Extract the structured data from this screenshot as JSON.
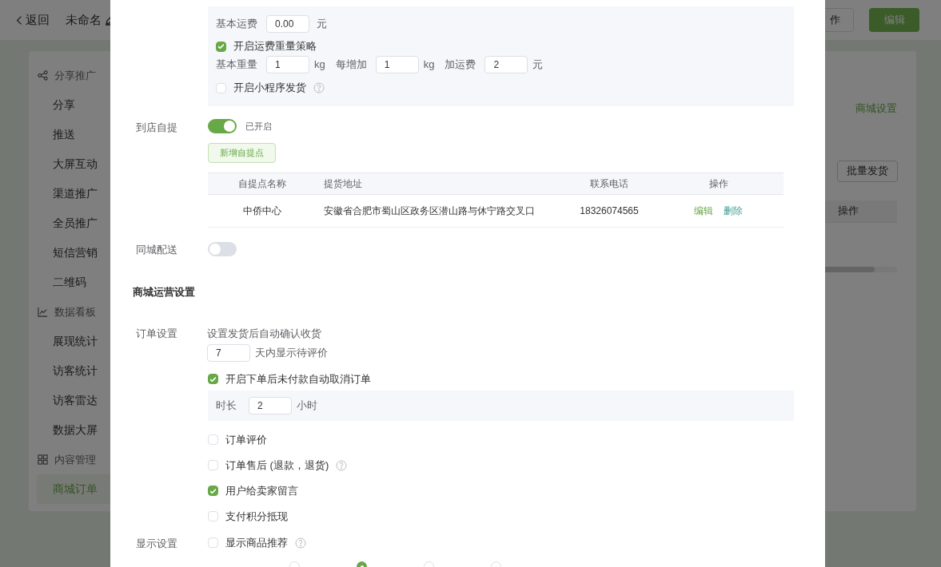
{
  "page": {
    "back": "返回",
    "title": "未命名",
    "header_buttons": [
      {
        "label": "作",
        "kind": "outline"
      },
      {
        "label": "编辑",
        "kind": "primary"
      }
    ],
    "sidebar": [
      {
        "group": "分享推广",
        "items": [
          {
            "label": "分享",
            "selected": false
          },
          {
            "label": "推送",
            "selected": false
          },
          {
            "label": "大屏互动",
            "selected": false
          },
          {
            "label": "渠道推广",
            "selected": false
          },
          {
            "label": "全员推广",
            "selected": false
          },
          {
            "label": "短信营销",
            "selected": false
          },
          {
            "label": "二维码",
            "selected": false
          }
        ]
      },
      {
        "group": "数据看板",
        "items": [
          {
            "label": "展现统计",
            "selected": false
          },
          {
            "label": "访客统计",
            "selected": false
          },
          {
            "label": "访客雷达",
            "selected": false
          },
          {
            "label": "数据大屏",
            "selected": false
          }
        ]
      },
      {
        "group": "内容管理",
        "items": [
          {
            "label": "商城订单",
            "selected": true
          }
        ]
      }
    ],
    "panel": {
      "link": "商城设置",
      "batch_button": "批量发货",
      "column": "操作"
    }
  },
  "modal": {
    "shipping_box": {
      "base_fee_label": "基本运费",
      "base_fee": "0.00",
      "base_fee_unit": "元",
      "weight_strategy": {
        "label": "开启运费重量策略",
        "checked": true
      },
      "weight_row": [
        {
          "label": "基本重量",
          "value": "1",
          "unit": "kg"
        },
        {
          "label": "每增加",
          "value": "1",
          "unit": "kg"
        },
        {
          "label": "加运费",
          "value": "2",
          "unit": "元"
        }
      ],
      "mini_program": {
        "label": "开启小程序发货",
        "checked": false,
        "help": true
      }
    },
    "pickup": {
      "label": "到店自提",
      "on": true,
      "status": "已开启",
      "add_button": "新增自提点",
      "columns": [
        "自提点名称",
        "提货地址",
        "联系电话",
        "操作"
      ],
      "rows": [
        {
          "name": "中侨中心",
          "address": "安徽省合肥市蜀山区政务区潜山路与休宁路交叉口",
          "phone": "18326074565",
          "actions": [
            "编辑",
            "删除"
          ]
        }
      ]
    },
    "local_delivery": {
      "label": "同城配送",
      "on": false
    },
    "section_title": "商城运营设置",
    "order": {
      "label": "订单设置",
      "auto_confirm_text": "设置发货后自动确认收货",
      "days": "7",
      "days_suffix": "天内显示待评价",
      "auto_cancel": {
        "label": "开启下单后未付款自动取消订单",
        "checked": true
      },
      "duration_label": "时长",
      "duration": "2",
      "duration_unit": "小时",
      "options": [
        {
          "label": "订单评价",
          "checked": false,
          "help": false
        },
        {
          "label": "订单售后 (退款，退货)",
          "checked": false,
          "help": true
        },
        {
          "label": "用户给卖家留言",
          "checked": true,
          "help": false
        },
        {
          "label": "支付积分抵现",
          "checked": false,
          "help": false
        }
      ]
    },
    "display": {
      "label": "显示设置",
      "recommend": {
        "label": "显示商品推荐",
        "checked": false,
        "help": true
      },
      "styles": [
        {
          "selected": false
        },
        {
          "selected": true
        },
        {
          "selected": false
        },
        {
          "selected": false
        }
      ]
    }
  }
}
